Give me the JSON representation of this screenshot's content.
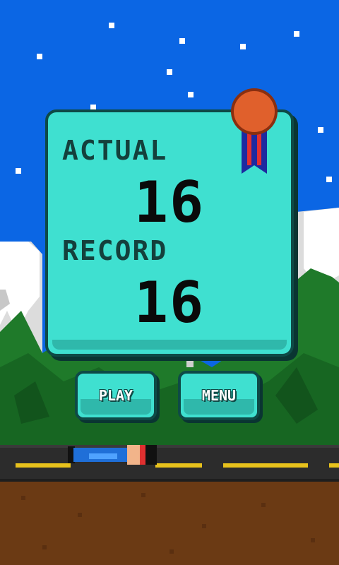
{
  "score_panel": {
    "actual_label": "ACTUAL",
    "actual_value": "16",
    "record_label": "RECORD",
    "record_value": "16"
  },
  "buttons": {
    "play_label": "PLAY",
    "menu_label": "MENU"
  },
  "icons": {
    "medal": "medal-icon",
    "character": "fallen-runner-sprite"
  },
  "colors": {
    "sky": "#0b66e4",
    "panel": "#3fe0d0",
    "panel_border": "#0e4a46",
    "medal": "#e0602c",
    "road_line": "#e8c21c",
    "dirt": "#6b3a14"
  }
}
